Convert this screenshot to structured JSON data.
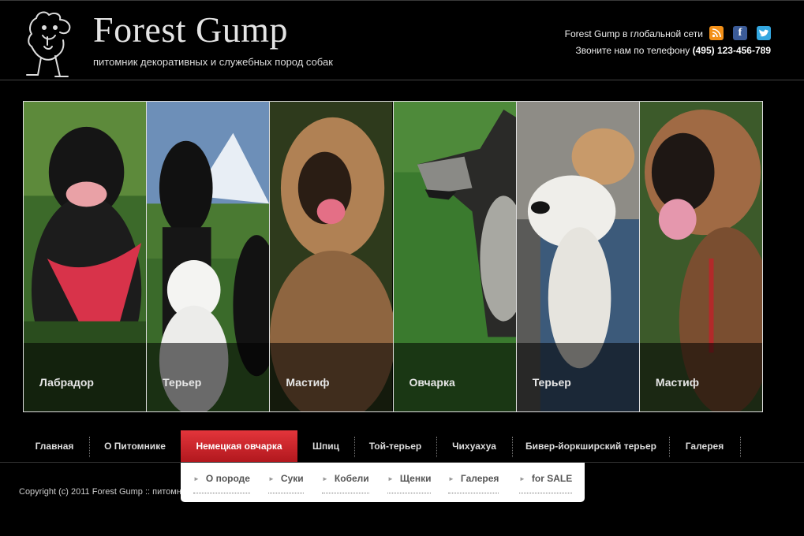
{
  "header": {
    "site_title": "Forest Gump",
    "tagline": "питомник декоративных и служебных пород собак",
    "social_text": "Forest Gump в глобальной сети",
    "phone_prefix": "Звоните нам по телефону",
    "phone_number": "(495) 123-456-789",
    "social_icons": [
      "rss-icon",
      "facebook-icon",
      "twitter-icon"
    ]
  },
  "gallery": [
    {
      "caption": "Лабрадор"
    },
    {
      "caption": "Терьер"
    },
    {
      "caption": "Мастиф"
    },
    {
      "caption": "Овчарка"
    },
    {
      "caption": "Терьер"
    },
    {
      "caption": "Мастиф"
    }
  ],
  "nav": {
    "items": [
      "Главная",
      "О Питомнике",
      "Немецкая овчарка",
      "Шпиц",
      "Той-терьер",
      "Чихуахуа",
      "Бивер-йоркширский терьер",
      "Галерея"
    ],
    "active": "Немецкая овчарка"
  },
  "submenu": {
    "items": [
      "О породе",
      "Суки",
      "Кобели",
      "Щенки",
      "Галерея",
      "for SALE"
    ]
  },
  "footer": {
    "copyright": "Copyright (c) 2011 Forest Gump :: питомн"
  },
  "colors": {
    "accent_red": "#d42a30",
    "rss": "#f39018",
    "facebook": "#3b5b97",
    "twitter": "#33a7e0"
  }
}
